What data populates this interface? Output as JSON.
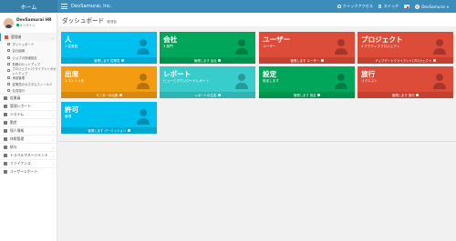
{
  "header": {
    "brand": "ホーム",
    "company": "DevSamurai, Inc.",
    "quick_access": "クイックアクセス",
    "switch": "スイッチ",
    "user": "DevSamurai"
  },
  "sidebar": {
    "user_name": "DevSamurai HR",
    "user_status": "オンライン",
    "menu_top": {
      "label": "管理者"
    },
    "sub_items": [
      "ダッシュボード",
      "会社組織",
      "ジョブの詳細設定",
      "勤務のセットアップ",
      "プロジェクト/クライアントのセットアップ",
      "承認管理",
      "従業員のカスタムフィールド",
      "社員旅行"
    ],
    "menu_items": [
      "従業員",
      "管理レポート",
      "システム",
      "勤怠",
      "個人情報",
      "休暇管理",
      "給与",
      "トラベルマネージメント",
      "ファイナンス",
      "ユーザーレポート"
    ]
  },
  "content": {
    "title": "ダッシュボード",
    "subtitle": "管理者"
  },
  "tiles": [
    {
      "title": "人",
      "sub": "1 従業員",
      "foot": "管理します 従業員",
      "color": "#00c0ef",
      "icon": "people-icon"
    },
    {
      "title": "会社",
      "sub": "3 部門",
      "foot": "管理します 会社",
      "color": "#00a65a",
      "icon": "sitemap-icon"
    },
    {
      "title": "ユーザー",
      "sub": "ユーザー",
      "foot": "管理します ユーザー",
      "color": "#dd4b39",
      "icon": "user-icon"
    },
    {
      "title": "プロジェクト",
      "sub": "4 アクティブプロジェクト",
      "foot": "アップデートクライアント/プロジェクト",
      "color": "#dd4b39",
      "icon": "clipboard-icon"
    },
    {
      "title": "出席",
      "sub": "1 エントリを",
      "foot": "モニターの出席",
      "color": "#f39c12",
      "icon": "clock-icon"
    },
    {
      "title": "レポート",
      "sub": "ビューとダウンロードレポート",
      "foot": "レポートの生成",
      "color": "#39cccc",
      "icon": "chart-icon"
    },
    {
      "title": "設定",
      "sub": "設定します",
      "foot": "管理します 設定",
      "color": "#00a65a",
      "icon": "tools-icon"
    },
    {
      "title": "旅行",
      "sub": "リクエスト",
      "foot": "管理します 旅行",
      "color": "#dd4b39",
      "icon": "plane-icon"
    },
    {
      "title": "許可",
      "sub": "管理",
      "foot": "管理します パーミッション",
      "color": "#00c0ef",
      "icon": "lock-icon"
    }
  ]
}
